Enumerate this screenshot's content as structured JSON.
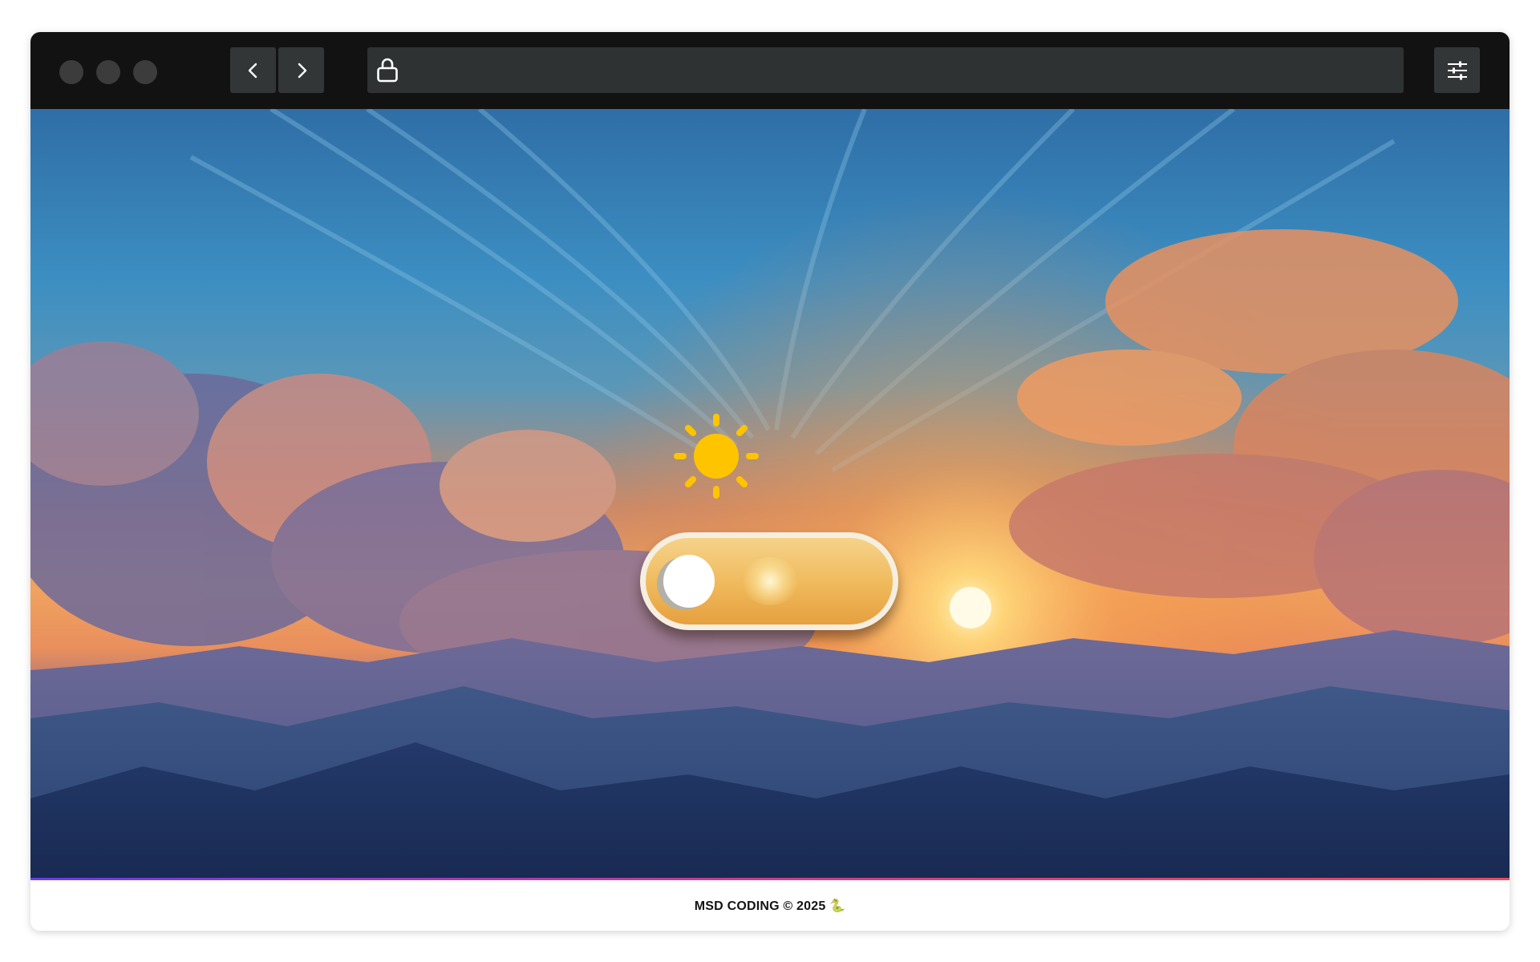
{
  "browser": {
    "window_controls": [
      "close-dot",
      "minimize-dot",
      "maximize-dot"
    ],
    "back_icon": "chevron-left-icon",
    "forward_icon": "chevron-right-icon",
    "address": {
      "value": "",
      "icon": "lock-icon"
    },
    "settings_icon": "sliders-icon"
  },
  "page": {
    "background": "sunset-sky-over-mountains",
    "weather_icon": "sun-icon",
    "theme_toggle": {
      "state": "day",
      "on": false
    },
    "footer_text": "MSD CODING © 2025 🐍"
  },
  "colors": {
    "titlebar": "#121212",
    "button": "#333637",
    "toggle_track": "#efb95a",
    "sun": "#ffc400",
    "footer_accent_start": "#6b3cf0",
    "footer_accent_end": "#f04a5a"
  }
}
